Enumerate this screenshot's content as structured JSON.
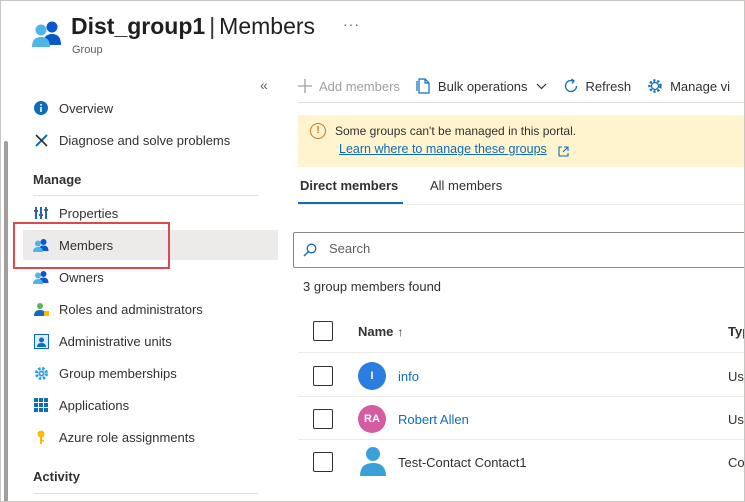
{
  "header": {
    "group_name": "Dist_group1",
    "separator": "|",
    "section": "Members",
    "subtitle": "Group",
    "more_label": "···"
  },
  "sidebar": {
    "collapse_label": "«",
    "items_top": [
      {
        "label": "Overview",
        "icon": "info-icon"
      },
      {
        "label": "Diagnose and solve problems",
        "icon": "wrench-icon"
      }
    ],
    "manage_heading": "Manage",
    "manage_items": [
      {
        "label": "Properties",
        "icon": "properties-icon"
      },
      {
        "label": "Members",
        "icon": "members-icon",
        "active": true
      },
      {
        "label": "Owners",
        "icon": "owners-icon"
      },
      {
        "label": "Roles and administrators",
        "icon": "roles-icon"
      },
      {
        "label": "Administrative units",
        "icon": "admin-units-icon"
      },
      {
        "label": "Group memberships",
        "icon": "gear-icon"
      },
      {
        "label": "Applications",
        "icon": "applications-icon"
      },
      {
        "label": "Azure role assignments",
        "icon": "key-icon"
      }
    ],
    "activity_heading": "Activity"
  },
  "toolbar": {
    "add_members": "Add members",
    "bulk_operations": "Bulk operations",
    "refresh": "Refresh",
    "manage_view": "Manage vi"
  },
  "banner": {
    "message": "Some groups can't be managed in this portal.",
    "link": "Learn where to manage these groups"
  },
  "tabs": {
    "direct": "Direct members",
    "all": "All members"
  },
  "search": {
    "placeholder": "Search"
  },
  "results": {
    "count_text": "3 group members found"
  },
  "table": {
    "col_name": "Name",
    "sort_indicator": "↑",
    "col_type": "Typ",
    "rows": [
      {
        "initials": "I",
        "name": "info",
        "type": "Use",
        "avatar_color": "#2b7de0",
        "is_link": true
      },
      {
        "initials": "RA",
        "name": "Robert Allen",
        "type": "Use",
        "avatar_color": "#d55ba2",
        "is_link": true
      },
      {
        "initials": "",
        "name": "Test-Contact Contact1",
        "type": "Co",
        "avatar_color": "#3aa0d8",
        "is_link": false
      }
    ]
  },
  "colors": {
    "accent": "#0f6cbd",
    "highlight_border": "#e0474c",
    "banner_bg": "#fff4ce"
  }
}
